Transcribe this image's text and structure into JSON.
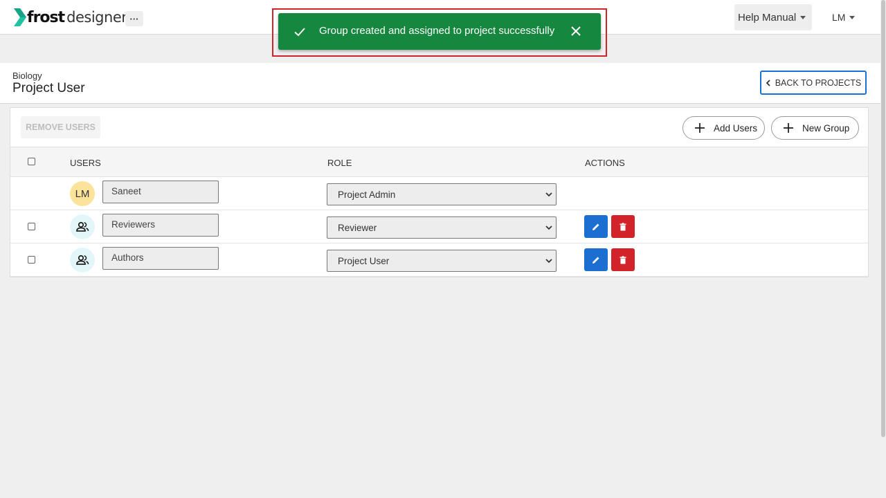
{
  "app": {
    "logo_frost": "frost",
    "logo_designer": "designer",
    "logo_icon": "chevron-logo-icon",
    "more_label": "···",
    "help_label": "Help Manual",
    "user_initials": "LM"
  },
  "toast": {
    "message": "Group created and assigned to project successfully",
    "icons": [
      "check-icon",
      "close-icon"
    ],
    "color": "#16873f"
  },
  "header": {
    "breadcrumb": "Biology",
    "title": "Project User",
    "back_label": "BACK TO PROJECTS"
  },
  "toolbar": {
    "remove_label": "REMOVE USERS",
    "add_users_label": "Add Users",
    "new_group_label": "New Group"
  },
  "table": {
    "columns": [
      "USERS",
      "ROLE",
      "ACTIONS"
    ],
    "rows": [
      {
        "avatar": "LM",
        "type": "user",
        "name": "Saneet",
        "role": "Project Admin"
      },
      {
        "avatar": "group-icon",
        "type": "group",
        "name": "Reviewers",
        "role": "Reviewer"
      },
      {
        "avatar": "group-icon",
        "type": "group",
        "name": "Authors",
        "role": "Project User"
      }
    ]
  },
  "colors": {
    "primary": "#1a6fd1",
    "danger": "#d3232a",
    "success": "#16873f",
    "logo_accent": "#1fc3a1"
  }
}
